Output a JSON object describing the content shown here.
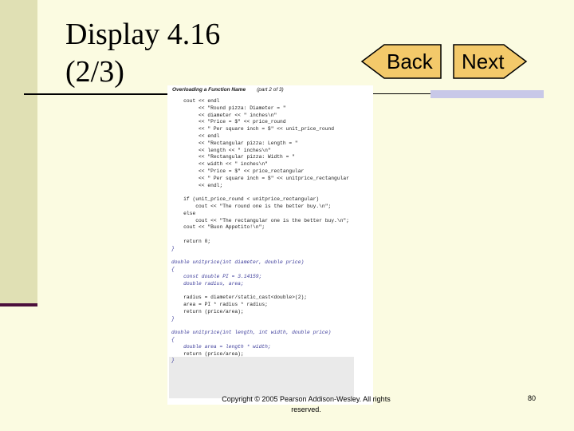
{
  "slide": {
    "title_line1": "Display 4.16",
    "title_line2": "(2/3)",
    "back_label": "Back",
    "next_label": "Next",
    "copyright": "Copyright © 2005 Pearson Addison-Wesley. All rights reserved.",
    "page_number": "80"
  },
  "code_image": {
    "heading": "Overloading a Function Name",
    "part": "(part 2 of 3)",
    "lines": [
      "    cout << endl",
      "         << \"Round pizza: Diameter = \"",
      "         << diameter << \" inches\\n\"",
      "         << \"Price = $\" << price_round",
      "         << \" Per square inch = $\" << unit_price_round",
      "         << endl",
      "         << \"Rectangular pizza: Length = \"",
      "         << length << \" inches\\n\"",
      "         << \"Rectangular pizza: Width = \"",
      "         << width << \" inches\\n\"",
      "         << \"Price = $\" << price_rectangular",
      "         << \" Per square inch = $\" << unitprice_rectangular",
      "         << endl;",
      "",
      "    if (unit_price_round < unitprice_rectangular)",
      "        cout << \"The round one is the better buy.\\n\";",
      "    else",
      "        cout << \"The rectangular one is the better buy.\\n\";",
      "    cout << \"Buon Appetito!\\n\";",
      "",
      "    return 0;",
      "}",
      "",
      "double unitprice(int diameter, double price)",
      "{",
      "    const double PI = 3.14159;",
      "    double radius, area;",
      "",
      "    radius = diameter/static_cast<double>(2);",
      "    area = PI * radius * radius;",
      "    return (price/area);",
      "}",
      "",
      "double unitprice(int length, int width, double price)",
      "{",
      "    double area = length * width;",
      "    return (price/area);",
      "}"
    ]
  },
  "colors": {
    "background": "#fbfbe1",
    "left_bar": "#e0e0b4",
    "accent_dark": "#4b0f3b",
    "back_arrow": "#f3c96a",
    "next_arrow": "#f3c96a",
    "rule_box": "#c8c8e8"
  }
}
